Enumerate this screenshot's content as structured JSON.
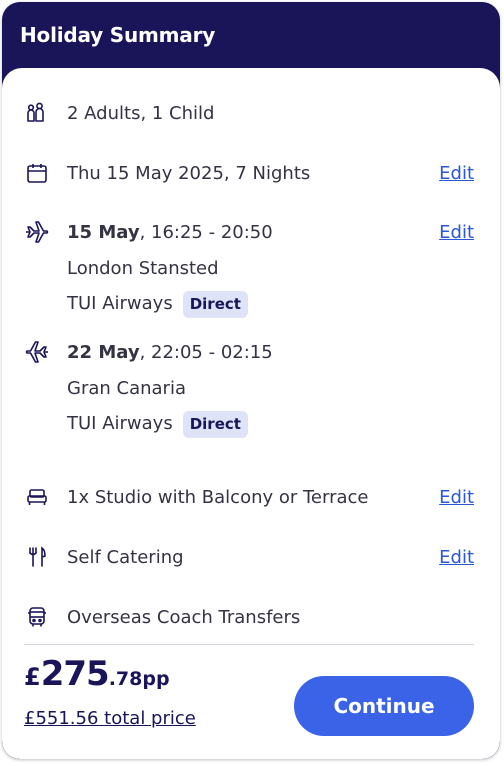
{
  "header": {
    "title": "Holiday Summary"
  },
  "colors": {
    "header_bg": "#1a1459",
    "accent": "#3b63e8",
    "link": "#2b56d6",
    "badge_bg": "#dfe3f7"
  },
  "passengers": {
    "icon": "people-icon",
    "text": "2 Adults, 1 Child"
  },
  "dates": {
    "icon": "calendar-icon",
    "text": "Thu 15 May 2025, 7 Nights",
    "edit_label": "Edit"
  },
  "outbound": {
    "icon": "plane-depart-icon",
    "date": "15 May",
    "times": ", 16:25 - 20:50",
    "airport": "London Stansted",
    "airline": "TUI Airways",
    "badge": "Direct",
    "edit_label": "Edit"
  },
  "inbound": {
    "icon": "plane-return-icon",
    "date": "22 May",
    "times": ", 22:05 - 02:15",
    "airport": "Gran Canaria",
    "airline": "TUI Airways",
    "badge": "Direct"
  },
  "room": {
    "icon": "bed-icon",
    "text": "1x Studio with Balcony or Terrace",
    "edit_label": "Edit"
  },
  "board": {
    "icon": "cutlery-icon",
    "text": "Self Catering",
    "edit_label": "Edit"
  },
  "transfer": {
    "icon": "coach-icon",
    "text": "Overseas Coach Transfers"
  },
  "footer": {
    "currency": "£",
    "price_main": "275",
    "price_decimal": ".78pp",
    "total_label": "£551.56 total price",
    "continue_label": "Continue"
  }
}
